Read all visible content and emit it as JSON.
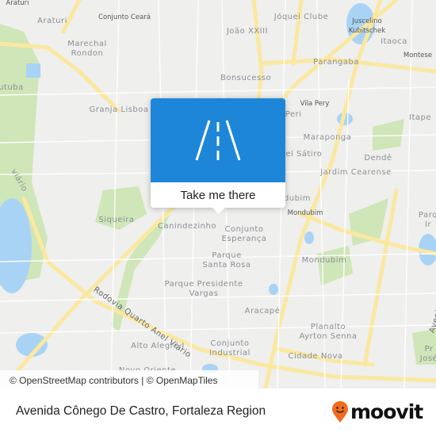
{
  "map": {
    "labels": {
      "araturi_small": "Araturi",
      "araturi": "Araturi",
      "conjunto_ceara": "Conjunto Ceará",
      "joquei_clube": "Jóquei Clube",
      "juscelino": "Juscelino\nKubitschek",
      "itaoca": "Itaoca",
      "montese": "Montese",
      "marechal_rondon": "Marechal\nRondon",
      "joao_xxiii": "João XXIII",
      "parangaba": "Parangaba",
      "bonsucesso": "Bonsucesso",
      "tuba": "utuba",
      "granja_lisboa": "Granja Lisboa",
      "vila_pery": "Vila Pery",
      "peri": "a Peri",
      "itape": "Itape",
      "maraponga": "Maraponga",
      "joel_satiro": "oel Sátiro",
      "dende": "Dendê",
      "jardim_cearense": "Jardim Cearense",
      "viario_top": "viário",
      "siqueira": "Siqueira",
      "canindezinho": "Canindezinho",
      "ubim": "dubim",
      "mondubim_small": "Mondubim",
      "conjunto_esperanca": "Conjunto\nEsperança",
      "parq_ir": "Parq\nIr",
      "parque_santa_rosa": "Parque\nSanta Rosa",
      "mondubim": "Mondubim",
      "parque_presidente_vargas": "Parque Presidente\nVargas",
      "rodovia": "Rodovia Quarto Anel Viário",
      "avenida_i": "Avenida I",
      "aracape": "Aracapé",
      "planalto": "Planalto\nAyrton Senna",
      "alto_alegre": "Alto Alegre I",
      "conjunto_industrial": "Conjunto\nIndustrial",
      "cidade_nova": "Cidade Nova",
      "pr_jose": "Pr\nJosé",
      "novo_oriente": "Novo Oriente"
    },
    "colors": {
      "background": "#efefed",
      "road": "#fbe8a0",
      "park": "#cfe6b8",
      "water": "#a9d3f5"
    }
  },
  "popup": {
    "icon": "road-icon",
    "button_label": "Take me there",
    "color": "#1e86d8"
  },
  "attribution": "© OpenStreetMap contributors | © OpenMapTiles",
  "footer": {
    "title": "Avenida Cônego De Castro, Fortaleza Region",
    "logo_text": "moovit",
    "logo_color": "#f26b1d"
  }
}
